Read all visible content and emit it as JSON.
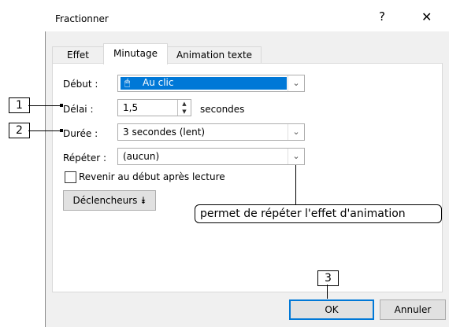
{
  "window": {
    "title": "Fractionner",
    "help_glyph": "?",
    "close_glyph": "✕"
  },
  "tabs": [
    {
      "label": "Effet"
    },
    {
      "label": "Minutage"
    },
    {
      "label": "Animation texte"
    }
  ],
  "form": {
    "debut_label": "Début :",
    "debut_value": "Au clic",
    "delai_label": "Délai :",
    "delai_value": "1,5",
    "delai_unit": "secondes",
    "duree_label": "Durée :",
    "duree_value": "3 secondes (lent)",
    "repeter_label": "Répéter :",
    "repeter_value": "(aucun)",
    "rewind_label": "Revenir au début après lecture",
    "triggers_label": "Déclencheurs"
  },
  "buttons": {
    "ok": "OK",
    "cancel": "Annuler"
  },
  "callouts": {
    "c1": "1",
    "c2": "2",
    "c3": "3"
  },
  "tooltip": "permet de répéter l'effet d'animation"
}
